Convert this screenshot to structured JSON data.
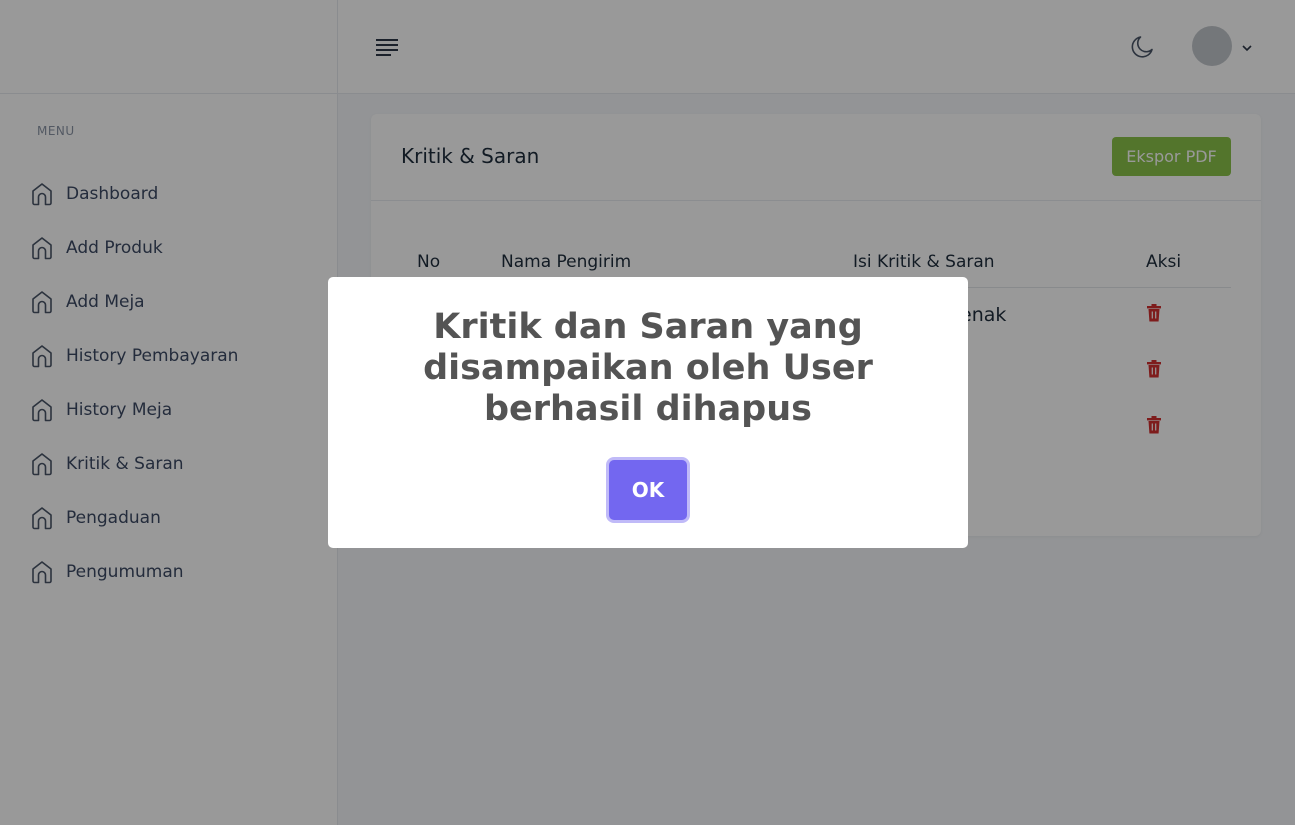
{
  "sidebar": {
    "menu_label": "MENU",
    "items": [
      {
        "label": "Dashboard"
      },
      {
        "label": "Add Produk"
      },
      {
        "label": "Add Meja"
      },
      {
        "label": "History Pembayaran"
      },
      {
        "label": "History Meja"
      },
      {
        "label": "Kritik & Saran"
      },
      {
        "label": "Pengaduan"
      },
      {
        "label": "Pengumuman"
      }
    ]
  },
  "card": {
    "title": "Kritik & Saran",
    "export_label": "Ekspor PDF"
  },
  "table": {
    "headers": [
      "No",
      "Nama Pengirim",
      "Isi Kritik & Saran",
      "Aksi"
    ],
    "rows": [
      {
        "no": "",
        "nama": "",
        "isi": "enak"
      },
      {
        "no": "",
        "nama": "",
        "isi": ""
      },
      {
        "no": "",
        "nama": "",
        "isi": ""
      }
    ]
  },
  "modal": {
    "title": "Kritik dan Saran yang disampaikan oleh User berhasil dihapus",
    "ok_label": "OK"
  },
  "colors": {
    "accent": "#7367f0",
    "export": "#8bc34a",
    "danger": "#d32f2f"
  }
}
